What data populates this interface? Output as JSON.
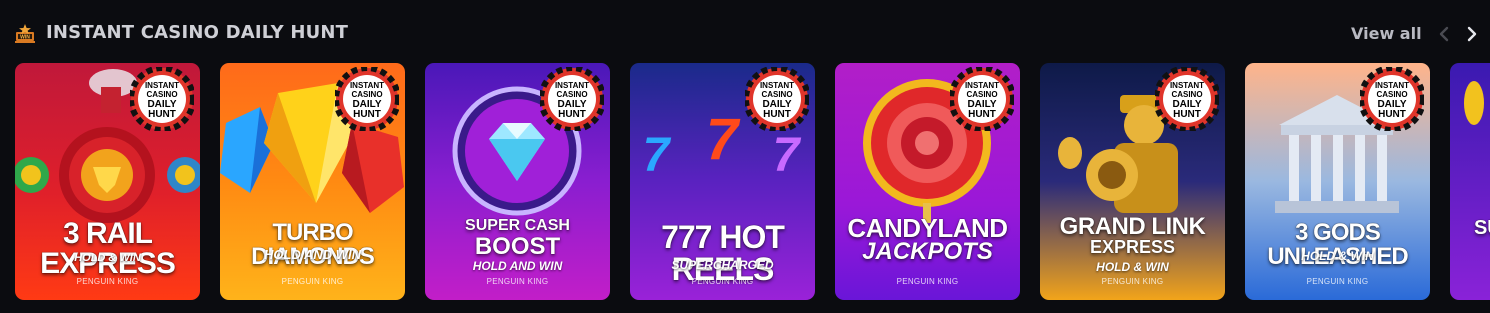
{
  "section": {
    "title": "INSTANT CASINO DAILY HUNT",
    "icon": "trophy-icon",
    "view_all": "View all"
  },
  "badge": {
    "line1": "INSTANT",
    "line2": "CASINO",
    "line3": "DAILY",
    "line4": "HUNT"
  },
  "games": [
    {
      "title": "3 RAIL EXPRESS",
      "subtitle": "HOLD & WIN",
      "provider": "PENGUIN KING"
    },
    {
      "title": "TURBO DIAMONDS",
      "subtitle": "HOLD AND WIN",
      "provider": "PENGUIN KING"
    },
    {
      "title_1": "SUPER CASH",
      "title_2": "BOOST",
      "subtitle": "HOLD AND WIN",
      "provider": "PENGUIN KING"
    },
    {
      "title": "777 HOT REELS",
      "subtitle": "SUPERCHARGED",
      "provider": "PENGUIN KING"
    },
    {
      "title_1": "CANDYLAND",
      "title_2": "JACKPOTS",
      "provider": "PENGUIN KING"
    },
    {
      "title_1": "GRAND LINK",
      "title_2": "EXPRESS",
      "subtitle": "HOLD & WIN",
      "provider": "PENGUIN KING"
    },
    {
      "title": "3 GODS UNLEASHED",
      "subtitle": "HOLD & WIN",
      "provider": "PENGUIN KING"
    },
    {
      "title": "SUP"
    }
  ]
}
